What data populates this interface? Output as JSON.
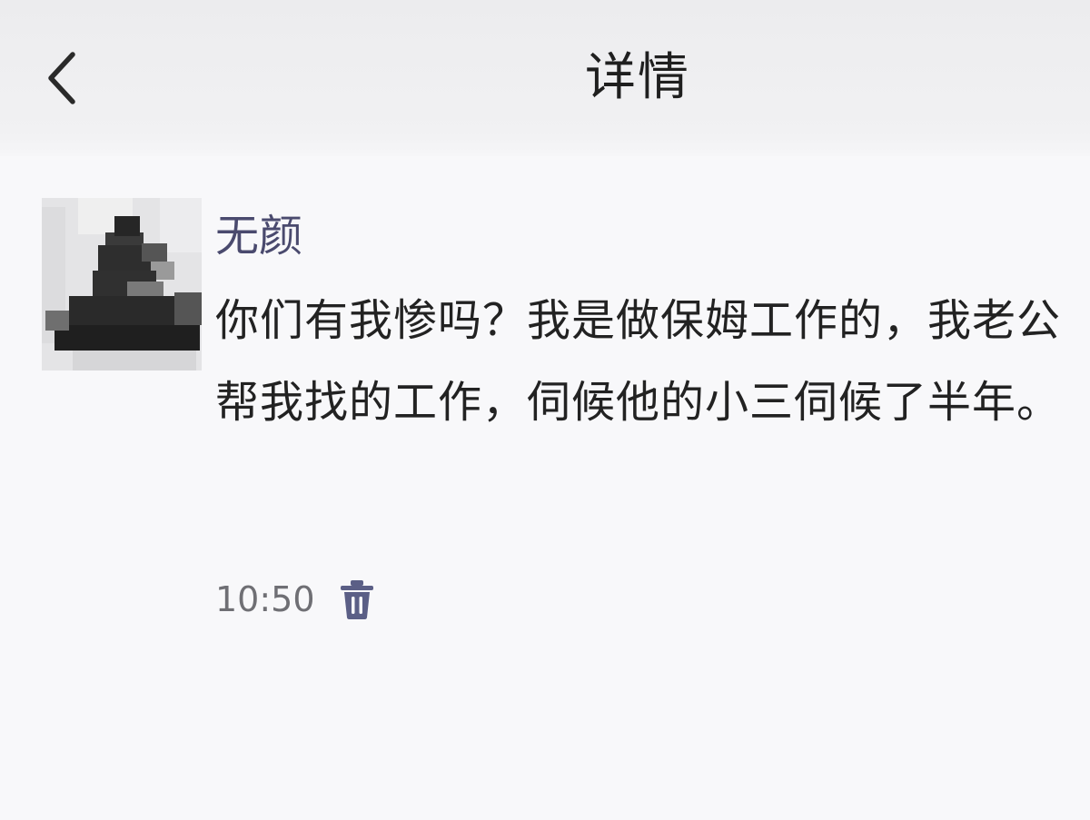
{
  "header": {
    "back_icon": "chevron-left-icon",
    "title": "详情"
  },
  "post": {
    "avatar_icon": "pixelated-avatar",
    "username": "无颜",
    "message": "你们有我惨吗？我是做保姆工作的，我老公帮我找的工作，伺候他的小三伺候了半年。",
    "timestamp": "10:50",
    "delete_icon": "trash-icon"
  },
  "colors": {
    "nav_background": "#ececee",
    "page_background": "#f8f8fa",
    "username": "#4a4a6e",
    "message_text": "#222222",
    "timestamp": "#6f6f74",
    "delete_icon": "#5b5f86"
  }
}
